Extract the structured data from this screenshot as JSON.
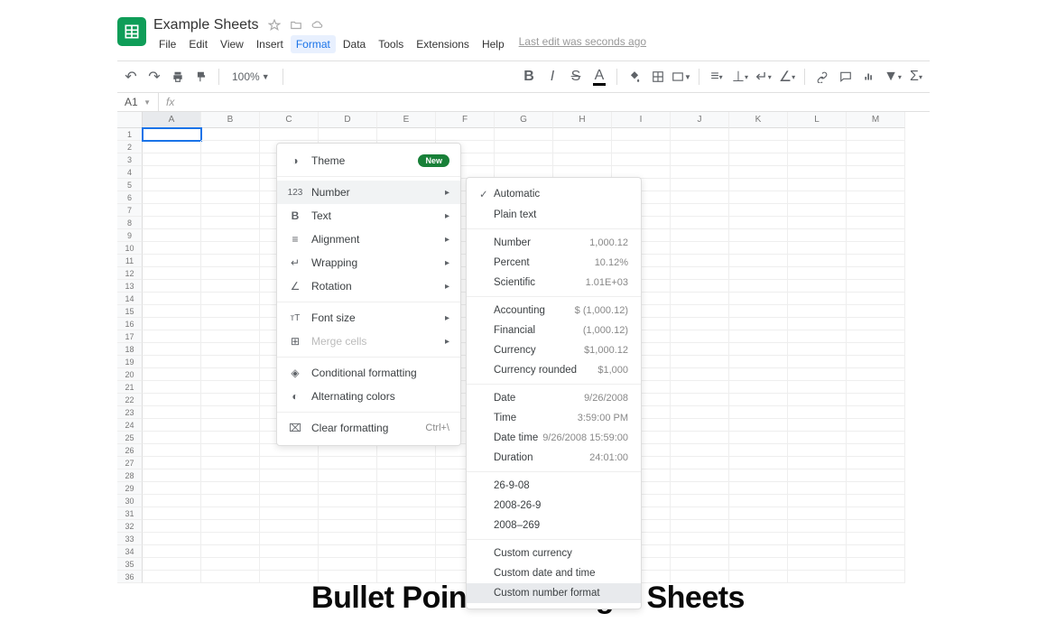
{
  "title": "Example Sheets",
  "menus": [
    "File",
    "Edit",
    "View",
    "Insert",
    "Format",
    "Data",
    "Tools",
    "Extensions",
    "Help"
  ],
  "activeMenu": "Format",
  "lastEdit": "Last edit was seconds ago",
  "zoom": "100%",
  "nameBox": "A1",
  "columns": [
    "A",
    "B",
    "C",
    "D",
    "E",
    "F",
    "G",
    "H",
    "I",
    "J",
    "K",
    "L",
    "M"
  ],
  "formatMenu": {
    "theme": "Theme",
    "themeBadge": "New",
    "number": "Number",
    "text": "Text",
    "alignment": "Alignment",
    "wrapping": "Wrapping",
    "rotation": "Rotation",
    "fontSize": "Font size",
    "mergeCells": "Merge cells",
    "conditional": "Conditional formatting",
    "alternating": "Alternating colors",
    "clear": "Clear formatting",
    "clearShortcut": "Ctrl+\\"
  },
  "numberMenu": {
    "automatic": "Automatic",
    "plainText": "Plain text",
    "number": {
      "label": "Number",
      "val": "1,000.12"
    },
    "percent": {
      "label": "Percent",
      "val": "10.12%"
    },
    "scientific": {
      "label": "Scientific",
      "val": "1.01E+03"
    },
    "accounting": {
      "label": "Accounting",
      "val": "$ (1,000.12)"
    },
    "financial": {
      "label": "Financial",
      "val": "(1,000.12)"
    },
    "currency": {
      "label": "Currency",
      "val": "$1,000.12"
    },
    "currencyRounded": {
      "label": "Currency rounded",
      "val": "$1,000"
    },
    "date": {
      "label": "Date",
      "val": "9/26/2008"
    },
    "time": {
      "label": "Time",
      "val": "3:59:00 PM"
    },
    "dateTime": {
      "label": "Date time",
      "val": "9/26/2008 15:59:00"
    },
    "duration": {
      "label": "Duration",
      "val": "24:01:00"
    },
    "fmt1": "26-9-08",
    "fmt2": "2008-26-9",
    "fmt3": "2008–269",
    "customCurrency": "Custom currency",
    "customDateTime": "Custom date and time",
    "customNumber": "Custom number format"
  },
  "caption": "Bullet Points in Google Sheets"
}
